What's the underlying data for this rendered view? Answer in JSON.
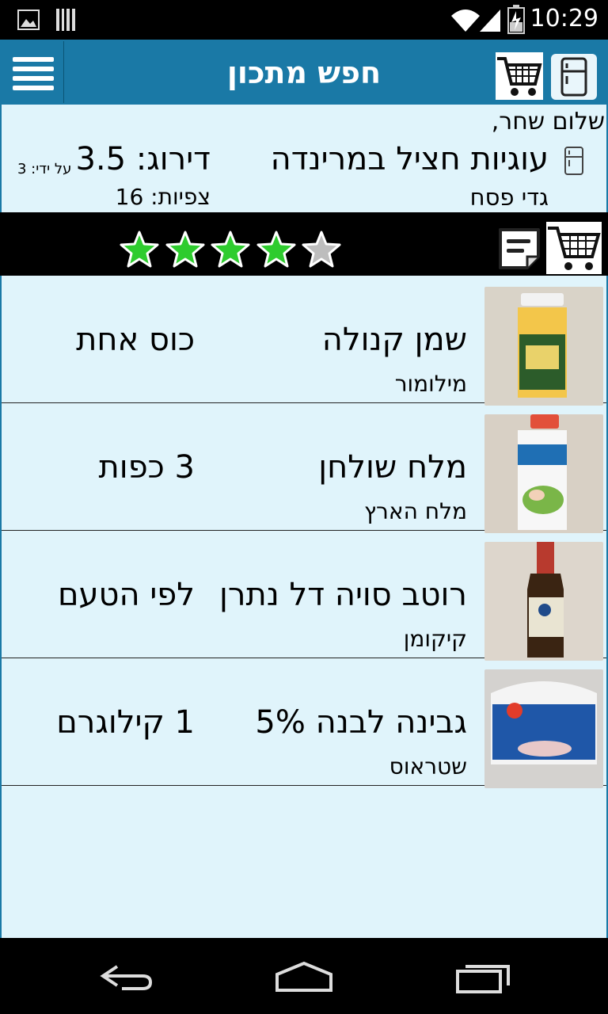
{
  "status_bar": {
    "time": "10:29"
  },
  "app_bar": {
    "title": "חפש מתכון"
  },
  "recipe": {
    "greeting": "שלום שחר,",
    "name": "עוגיות חציל במרינדה",
    "author": "גדי פסח",
    "rating_text": "דירוג: 3.5",
    "views_text": "צפיות: 16",
    "rated_by_text": "על ידי: 3",
    "stars_filled": 4,
    "stars_total": 5
  },
  "ingredients": [
    {
      "name": "שמן קנולה",
      "brand": "מילומור",
      "quantity": "כוס אחת"
    },
    {
      "name": "מלח שולחן",
      "brand": "מלח הארץ",
      "quantity": "3 כפות"
    },
    {
      "name": "רוטב סויה דל נתרן",
      "brand": "קיקומן",
      "quantity": "לפי הטעם"
    },
    {
      "name": "גבינה לבנה 5%",
      "brand": "שטראוס",
      "quantity": "1 קילוגרם"
    }
  ],
  "colors": {
    "app_bar": "#1a79a6",
    "content_bg": "#e0f4fb",
    "star_filled": "#2ecc2e",
    "star_empty": "#bdbdbd"
  }
}
